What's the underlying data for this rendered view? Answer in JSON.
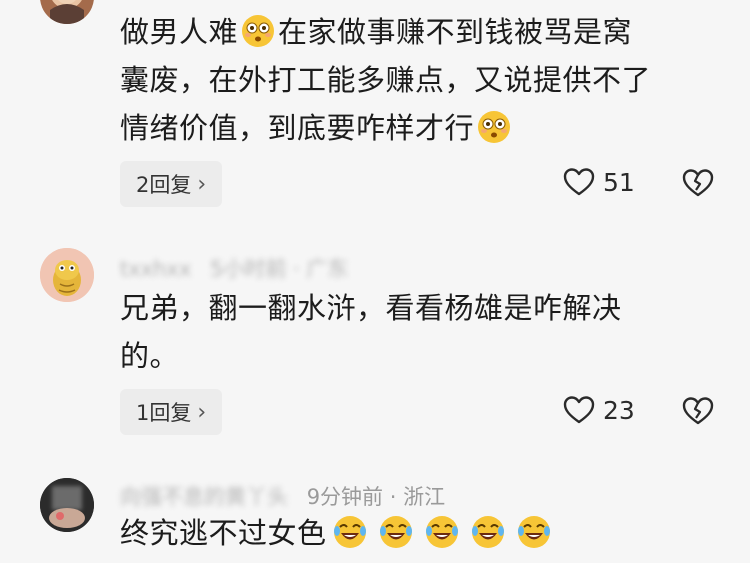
{
  "comments": [
    {
      "text_lines": [
        "做男人难",
        "在家做事赚不到钱被骂是窝",
        "囊废，在外打工能多赚点，又说提供不了",
        "情绪价值，到底要咋样才行"
      ],
      "reply_label": "2回复",
      "like_count": "51"
    },
    {
      "username": "txxhxx",
      "meta": "5小时前 · 广东",
      "text_lines": [
        "兄弟，翻一翻水浒，看看杨雄是咋解决",
        "的。"
      ],
      "reply_label": "1回复",
      "like_count": "23"
    },
    {
      "username": "向强不息的黄丫头",
      "meta": "9分钟前 · 浙江",
      "text_lines": [
        "终究逃不过女色"
      ]
    }
  ],
  "icons": {
    "like": "heart-outline-icon",
    "dislike": "broken-heart-icon",
    "reply_chevron": "chevron-right-icon",
    "emoji_flushed": "flushed-emoji-icon",
    "emoji_laugh": "laughing-crying-emoji-icon"
  },
  "colors": {
    "background": "#f6f6f6",
    "pill_bg": "#ececec",
    "meta_gray": "#9a9a9a",
    "emoji_yellow": "#f7c536"
  }
}
